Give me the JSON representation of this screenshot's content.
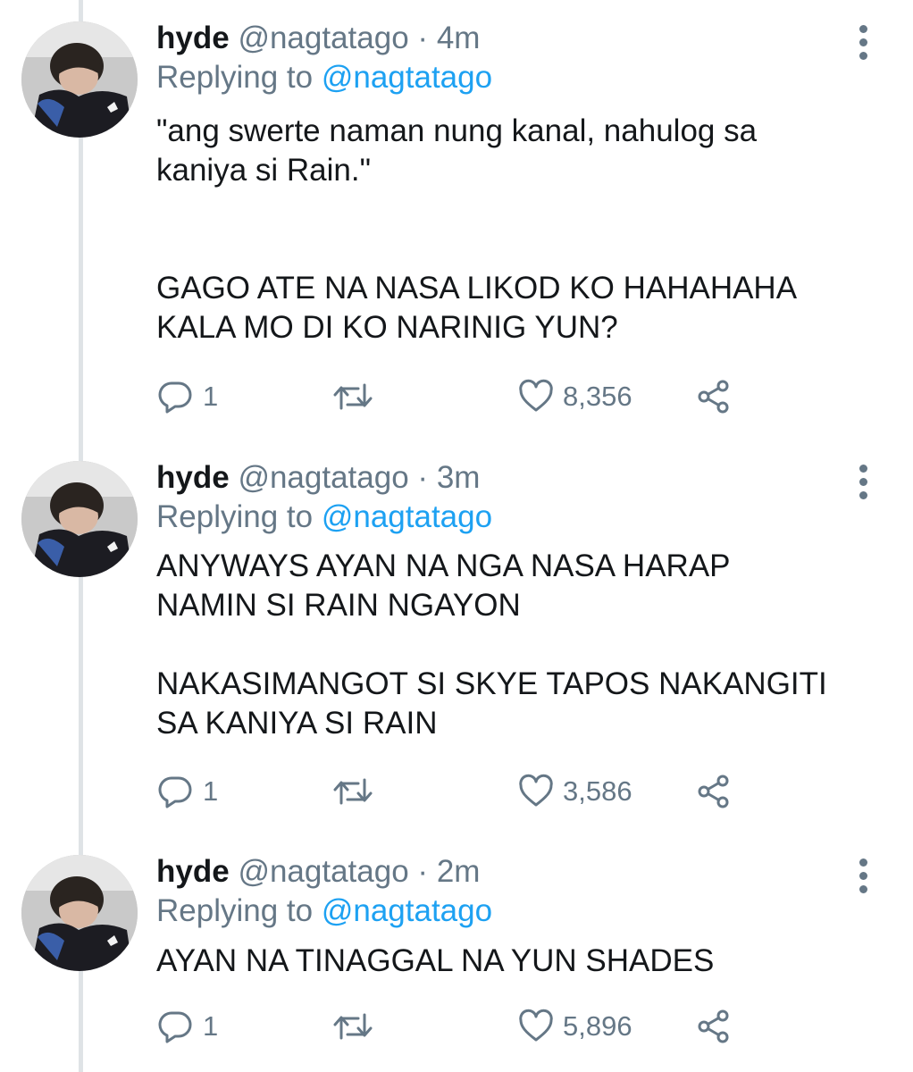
{
  "tweets": [
    {
      "name": "hyde",
      "handle": "@nagtatago",
      "separator": "·",
      "time": "4m",
      "replying_prefix": "Replying to",
      "replying_handle": "@nagtatago",
      "paragraphs": [
        "\"ang swerte naman nung kanal, nahulog sa",
        "kaniya si Rain.\"",
        "",
        "",
        "GAGO ATE NA NASA LIKOD KO HAHAHAHA",
        "KALA MO DI KO NARINIG YUN?"
      ],
      "replies": "1",
      "retweets": "",
      "likes": "8,356"
    },
    {
      "name": "hyde",
      "handle": "@nagtatago",
      "separator": "·",
      "time": "3m",
      "replying_prefix": "Replying to",
      "replying_handle": "@nagtatago",
      "paragraphs": [
        "ANYWAYS AYAN NA NGA NASA HARAP",
        "NAMIN SI RAIN NGAYON",
        "",
        "NAKASIMANGOT SI SKYE TAPOS NAKANGITI",
        "SA KANIYA SI RAIN"
      ],
      "replies": "1",
      "retweets": "",
      "likes": "3,586"
    },
    {
      "name": "hyde",
      "handle": "@nagtatago",
      "separator": "·",
      "time": "2m",
      "replying_prefix": "Replying to",
      "replying_handle": "@nagtatago",
      "paragraphs": [
        "AYAN NA TINAGGAL NA YUN SHADES"
      ],
      "replies": "1",
      "retweets": "",
      "likes": "5,896"
    }
  ],
  "icons": {
    "reply": "reply-icon",
    "retweet": "retweet-icon",
    "like": "heart-icon",
    "share": "share-icon",
    "more": "more-vertical-icon"
  },
  "colors": {
    "text": "#14171a",
    "secondary": "#657786",
    "link": "#1da1f2",
    "thread_line": "#dfe3e6"
  }
}
